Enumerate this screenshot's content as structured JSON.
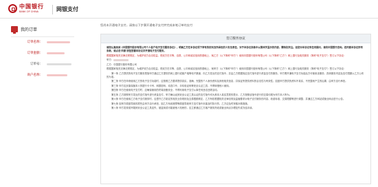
{
  "header": {
    "bank_name": "中国银行",
    "bank_name_en": "BANK OF CHINA",
    "app_title": "网银支付"
  },
  "sidebar": {
    "title": "我的订单",
    "fields": [
      {
        "label": "订单名称：",
        "color": "red"
      },
      {
        "label": "订单金额：",
        "color": "red"
      },
      {
        "label": "订单号：",
        "color": "gray"
      },
      {
        "label": "商户名称：",
        "color": "red"
      }
    ]
  },
  "main": {
    "hint": "您尚未开通电子支付，请按以下步骤开通电子支付并完成本笔订单的支付",
    "panel_title": "签订服务协议",
    "agreement": {
      "intro": "请您认真阅读《中国银行股份有限公司个人客户电子支付服务协议》，明确乙方在本协议项下享有的权利及所承担的义务及责任，对于本协议条款中以黑体字显示的内容，需特别关注。如您对本协议有任何疑问，请向中国银行咨询。若同意本协议所有条款，请点击'同意'按钮签署本协议并开通电子支付服务。",
      "notice": "根据国家相关法律法规规定，为维护双方合法权益，现双方在平等、自愿、公平和诚实信用的基础上，就乙方（以下简称\"甲方\"）使用中国银行股份有限公司（以下简称\"乙方\"）网上银行及相关服务（简称\"电子支付\"）签订以下协议：",
      "party_b": "乙方：中国银行股份有限公司",
      "preamble": "根据国家相关法律法规规定，为维护双方合法权益，现双方在平等、自愿、公平和诚实信用的基础上，就甲方（以下简称\"甲方\"）使用中国银行股份有限公司（以下简称\"乙方\"）网上银行及相关服务（简称\"电子支付\"）签订以下协议：",
      "clauses": [
        "第一条 乙方提供的电子支付服务是指甲方通过乙方提供的网上银行或客户端等电子渠道，向乙方发出的支付指令，并由乙方根据相应支付指令进行资金支付的服务。甲方需开通电子支付功能后方可使用该服务，具体服务内容及支付限额以乙方公布的为准。",
        "第二条 甲方在申请使用乙方的电子支付功能时，应按照乙方要求提供真实、准确、完整的个人身份资料及其他相关信息，并保证所提供资料的合法性与有效性；如因甲方提供的资料不真实、不完整而产生的后果，由甲方自行承担。",
        "第三条 甲方应妥善保管本人的银行卡卡号、网银密码、动态口令、手机验证码等安全认证工具，不得转借他人使用。",
        "第四条 甲方在使用电子支付时，应确保使用的终端设备安全，不得利用电子支付从事任何违法违规活动。",
        "第五条 乙方按照甲方发出的支付指令进行资金支付，甲方确认经其安全认证工具认证的支付指令均为其本人真实意愿的表示，乙方按照该指令进行的交易均视为甲方本人所为。",
        "第六条 甲方在使用乙方电子支付服务时，应遵守乙方制定的相关业务规则及交易限额规定，乙方有权根据相关法律法规及监管要求对电子支付服务的内容、收费标准、交易限额等进行调整，并通过乙方网站或营业网点进行公告。",
        "第七条 因甲方原因导致的损失由甲方自行承担，因乙方系统故障等原因导致甲方支付指令未能及时执行的，乙方应及时采取补救措施。",
        "第八条 甲方发现或怀疑其安全认证工具遗失、被盗用或可能被他人知悉的，应立即通过乙方客户服务热线或营业网点办理挂失或冻结手续。"
      ]
    }
  },
  "colors": {
    "brand_red": "#b8141b",
    "label_red": "#c02a2a",
    "panel_header_bg": "#eef1f4"
  }
}
